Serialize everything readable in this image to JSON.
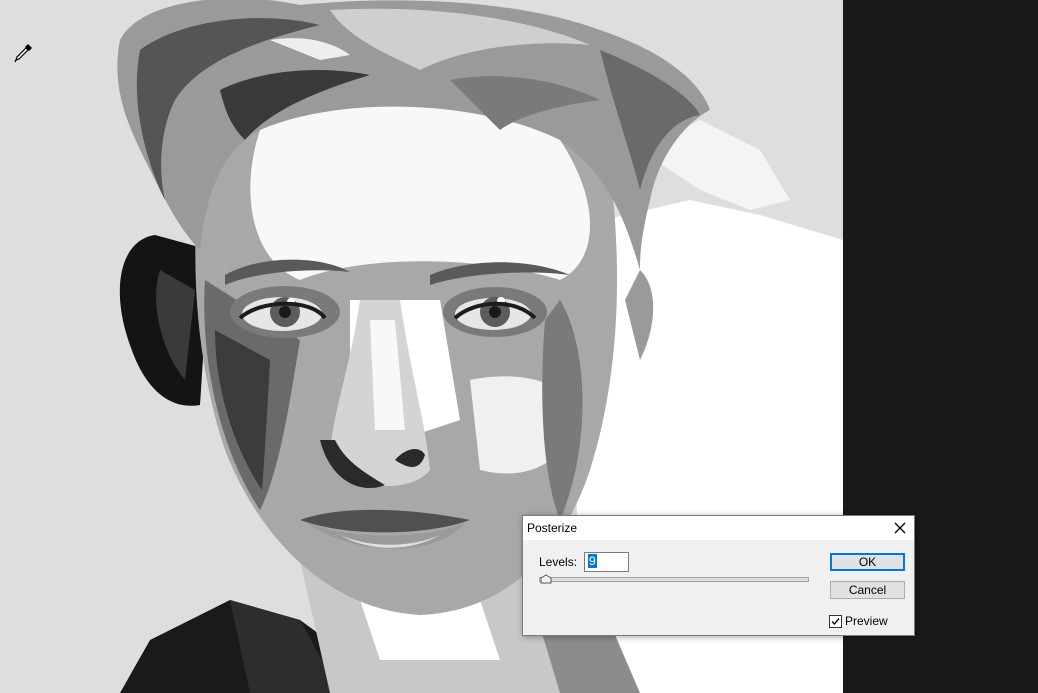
{
  "dialog": {
    "title": "Posterize",
    "levels_label": "Levels:",
    "levels_value": "9",
    "ok_label": "OK",
    "cancel_label": "Cancel",
    "preview_label": "Preview",
    "preview_checked": true
  },
  "colors": {
    "canvas_bg": "#dedede",
    "app_bg": "#191919",
    "dialog_bg": "#f0f0f0",
    "accent": "#0078d7"
  },
  "icons": {
    "tool_cursor": "eyedropper-icon",
    "close": "close-icon",
    "check": "checkmark-icon"
  }
}
